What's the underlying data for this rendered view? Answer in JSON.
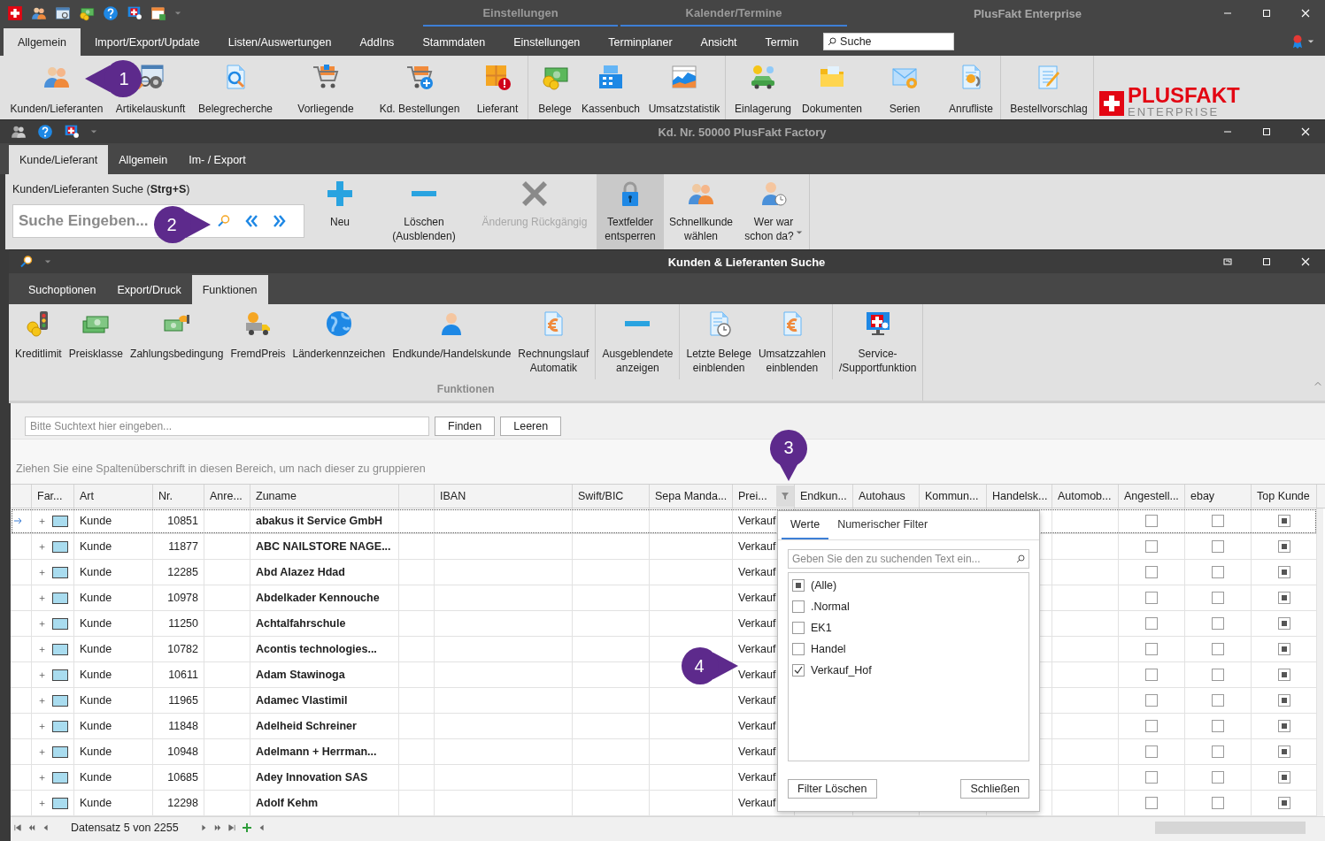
{
  "app": {
    "context_tabs": [
      "Einstellungen",
      "Kalender/Termine"
    ],
    "title": "PlusFakt Enterprise",
    "menu_tabs": [
      {
        "label": "Allgemein",
        "selected": true
      },
      {
        "label": "Import/Export/Update",
        "selected": false
      },
      {
        "label": "Listen/Auswertungen",
        "selected": false
      },
      {
        "label": "AddIns",
        "selected": false
      },
      {
        "label": "Stammdaten",
        "selected": false
      },
      {
        "label": "Einstellungen",
        "selected": false
      },
      {
        "label": "Terminplaner",
        "selected": false
      },
      {
        "label": "Ansicht",
        "selected": false
      },
      {
        "label": "Termin",
        "selected": false
      }
    ],
    "search": {
      "placeholder": "Suche"
    },
    "ribbon_groups": [
      {
        "items": [
          "Kunden/Lieferanten",
          "Artikelauskunft",
          "Belegrecherche",
          "Vorliegende",
          "Kd. Bestellungen",
          "Lieferant"
        ]
      },
      {
        "items": [
          "Belege",
          "Kassenbuch",
          "Umsatzstatistik"
        ]
      },
      {
        "items": [
          "Einlagerung",
          "Dokumenten",
          "Serien",
          "Anrufliste"
        ]
      },
      {
        "items": [
          "Bestellvorschlag"
        ]
      }
    ],
    "logo": {
      "name": "PLUSFAKT",
      "subtitle": "ENTERPRISE"
    }
  },
  "customer_window": {
    "title": "Kd. Nr. 50000 PlusFakt Factory",
    "tabs": [
      {
        "label": "Kunde/Lieferant",
        "selected": true
      },
      {
        "label": "Allgemein",
        "selected": false
      },
      {
        "label": "Im- / Export",
        "selected": false
      }
    ],
    "search": {
      "label": "Kunden/Lieferanten Suche (**Strg+S**)",
      "placeholder": "Suche Eingeben..."
    },
    "buttons": [
      {
        "lines": [
          "Neu"
        ],
        "disabled": false,
        "pressed": false,
        "kind": "button"
      },
      {
        "lines": [
          "Löschen",
          "(Ausblenden)"
        ],
        "disabled": false,
        "pressed": false,
        "kind": "button"
      },
      {
        "lines": [
          "Änderung Rückgängig"
        ],
        "disabled": true,
        "pressed": false,
        "kind": "button"
      },
      {
        "lines": [
          "Textfelder",
          "entsperren"
        ],
        "disabled": false,
        "pressed": true,
        "kind": "button"
      },
      {
        "lines": [
          "Schnellkunde",
          "wählen"
        ],
        "disabled": false,
        "pressed": false,
        "kind": "button"
      },
      {
        "lines": [
          "Wer war",
          "schon da?"
        ],
        "disabled": false,
        "pressed": false,
        "kind": "dropdown"
      }
    ]
  },
  "search_window": {
    "title": "Kunden & Lieferanten Suche",
    "tabs": [
      {
        "label": "Suchoptionen",
        "selected": false
      },
      {
        "label": "Export/Druck",
        "selected": false
      },
      {
        "label": "Funktionen",
        "selected": true
      }
    ],
    "ribbon_groups": [
      {
        "items": [
          [
            "Kreditlimit"
          ],
          [
            "Preisklasse"
          ],
          [
            "Zahlungsbedingung"
          ],
          [
            "FremdPreis"
          ],
          [
            "Länderkennzeichen"
          ],
          [
            "Endkunde/Handelskunde"
          ],
          [
            "Rechnungslauf",
            "Automatik"
          ]
        ]
      },
      {
        "items": [
          [
            "Ausgeblendete",
            "anzeigen"
          ]
        ]
      },
      {
        "items": [
          [
            "Letzte Belege",
            "einblenden"
          ],
          [
            "Umsatzzahlen",
            "einblenden"
          ]
        ]
      },
      {
        "items": [
          [
            "Service-",
            "/Supportfunktion"
          ]
        ]
      }
    ],
    "group_label": "Funktionen",
    "search": {
      "placeholder": "Bitte Suchtext hier eingeben..."
    },
    "buttons": [
      "Finden",
      "Leeren"
    ],
    "group_hint": "Ziehen Sie eine Spaltenüberschrift in diesen Bereich, um nach dieser zu gruppieren",
    "table": {
      "columns": [
        {
          "label": "Far...",
          "filtered": false
        },
        {
          "label": "Art",
          "filtered": false
        },
        {
          "label": "Nr.",
          "filtered": false
        },
        {
          "label": "Anre...",
          "filtered": false
        },
        {
          "label": "Zuname",
          "filtered": false
        },
        {
          "filtered": false
        },
        {
          "label": "IBAN",
          "filtered": false
        },
        {
          "label": "Swift/BIC",
          "filtered": false
        },
        {
          "label": "Sepa Manda...",
          "filtered": false
        },
        {
          "label": "Prei...",
          "filtered": true
        },
        {
          "label": "Endkun...",
          "filtered": false
        },
        {
          "label": "Autohaus",
          "filtered": false
        },
        {
          "label": "Kommun...",
          "filtered": false
        },
        {
          "label": "Handelsk...",
          "filtered": false
        },
        {
          "label": "Automob...",
          "filtered": false
        },
        {
          "label": "Angestell...",
          "filtered": false
        },
        {
          "label": "ebay",
          "filtered": false
        },
        {
          "label": "Top Kunde",
          "filtered": false
        }
      ],
      "rows": [
        {
          "selected": true,
          "art": "Kunde",
          "nr": "10851",
          "zuname": "abakus it Service GmbH",
          "preis": "Verkauf",
          "angestellt": false,
          "ebay": false,
          "top_kunde": true
        },
        {
          "selected": false,
          "art": "Kunde",
          "nr": "11877",
          "zuname": "ABC NAILSTORE NAGE...",
          "preis": "Verkauf",
          "angestellt": false,
          "ebay": false,
          "top_kunde": true
        },
        {
          "selected": false,
          "art": "Kunde",
          "nr": "12285",
          "zuname": "Abd Alazez Hdad",
          "preis": "Verkauf",
          "angestellt": false,
          "ebay": false,
          "top_kunde": true
        },
        {
          "selected": false,
          "art": "Kunde",
          "nr": "10978",
          "zuname": "Abdelkader Kennouche",
          "preis": "Verkauf",
          "angestellt": false,
          "ebay": false,
          "top_kunde": true
        },
        {
          "selected": false,
          "art": "Kunde",
          "nr": "11250",
          "zuname": "Achtalfahrschule",
          "preis": "Verkauf",
          "angestellt": false,
          "ebay": false,
          "top_kunde": true
        },
        {
          "selected": false,
          "art": "Kunde",
          "nr": "10782",
          "zuname": "Acontis technologies...",
          "preis": "Verkauf",
          "angestellt": false,
          "ebay": false,
          "top_kunde": true
        },
        {
          "selected": false,
          "art": "Kunde",
          "nr": "10611",
          "zuname": "Adam Stawinoga",
          "preis": "Verkauf",
          "angestellt": false,
          "ebay": false,
          "top_kunde": true
        },
        {
          "selected": false,
          "art": "Kunde",
          "nr": "11965",
          "zuname": "Adamec Vlastimil",
          "preis": "Verkauf",
          "angestellt": false,
          "ebay": false,
          "top_kunde": true
        },
        {
          "selected": false,
          "art": "Kunde",
          "nr": "11848",
          "zuname": "Adelheid Schreiner",
          "preis": "Verkauf",
          "angestellt": false,
          "ebay": false,
          "top_kunde": true
        },
        {
          "selected": false,
          "art": "Kunde",
          "nr": "10948",
          "zuname": "Adelmann + Herrman...",
          "preis": "Verkauf",
          "angestellt": false,
          "ebay": false,
          "top_kunde": true
        },
        {
          "selected": false,
          "art": "Kunde",
          "nr": "10685",
          "zuname": "Adey Innovation SAS",
          "preis": "Verkauf",
          "angestellt": false,
          "ebay": false,
          "top_kunde": true
        },
        {
          "selected": false,
          "art": "Kunde",
          "nr": "12298",
          "zuname": "Adolf Kehm",
          "preis": "Verkauf",
          "angestellt": false,
          "ebay": false,
          "top_kunde": true
        }
      ]
    },
    "filter_popup": {
      "tabs": [
        {
          "label": "Werte",
          "selected": true
        },
        {
          "label": "Numerischer Filter",
          "selected": false
        }
      ],
      "search": {
        "placeholder": "Geben Sie den zu suchenden Text ein..."
      },
      "items": [
        {
          "label": "(Alle)",
          "checked": true
        },
        {
          "label": ".Normal",
          "checked": false
        },
        {
          "label": "EK1",
          "checked": false
        },
        {
          "label": "Handel",
          "checked": false
        },
        {
          "label": "Verkauf_Hof",
          "checked": true
        }
      ],
      "buttons": [
        "Filter Löschen",
        "Schließen"
      ]
    },
    "navigator": {
      "text": "Datensatz 5 von 2255"
    }
  },
  "callouts": [
    "1",
    "2",
    "3",
    "4"
  ]
}
